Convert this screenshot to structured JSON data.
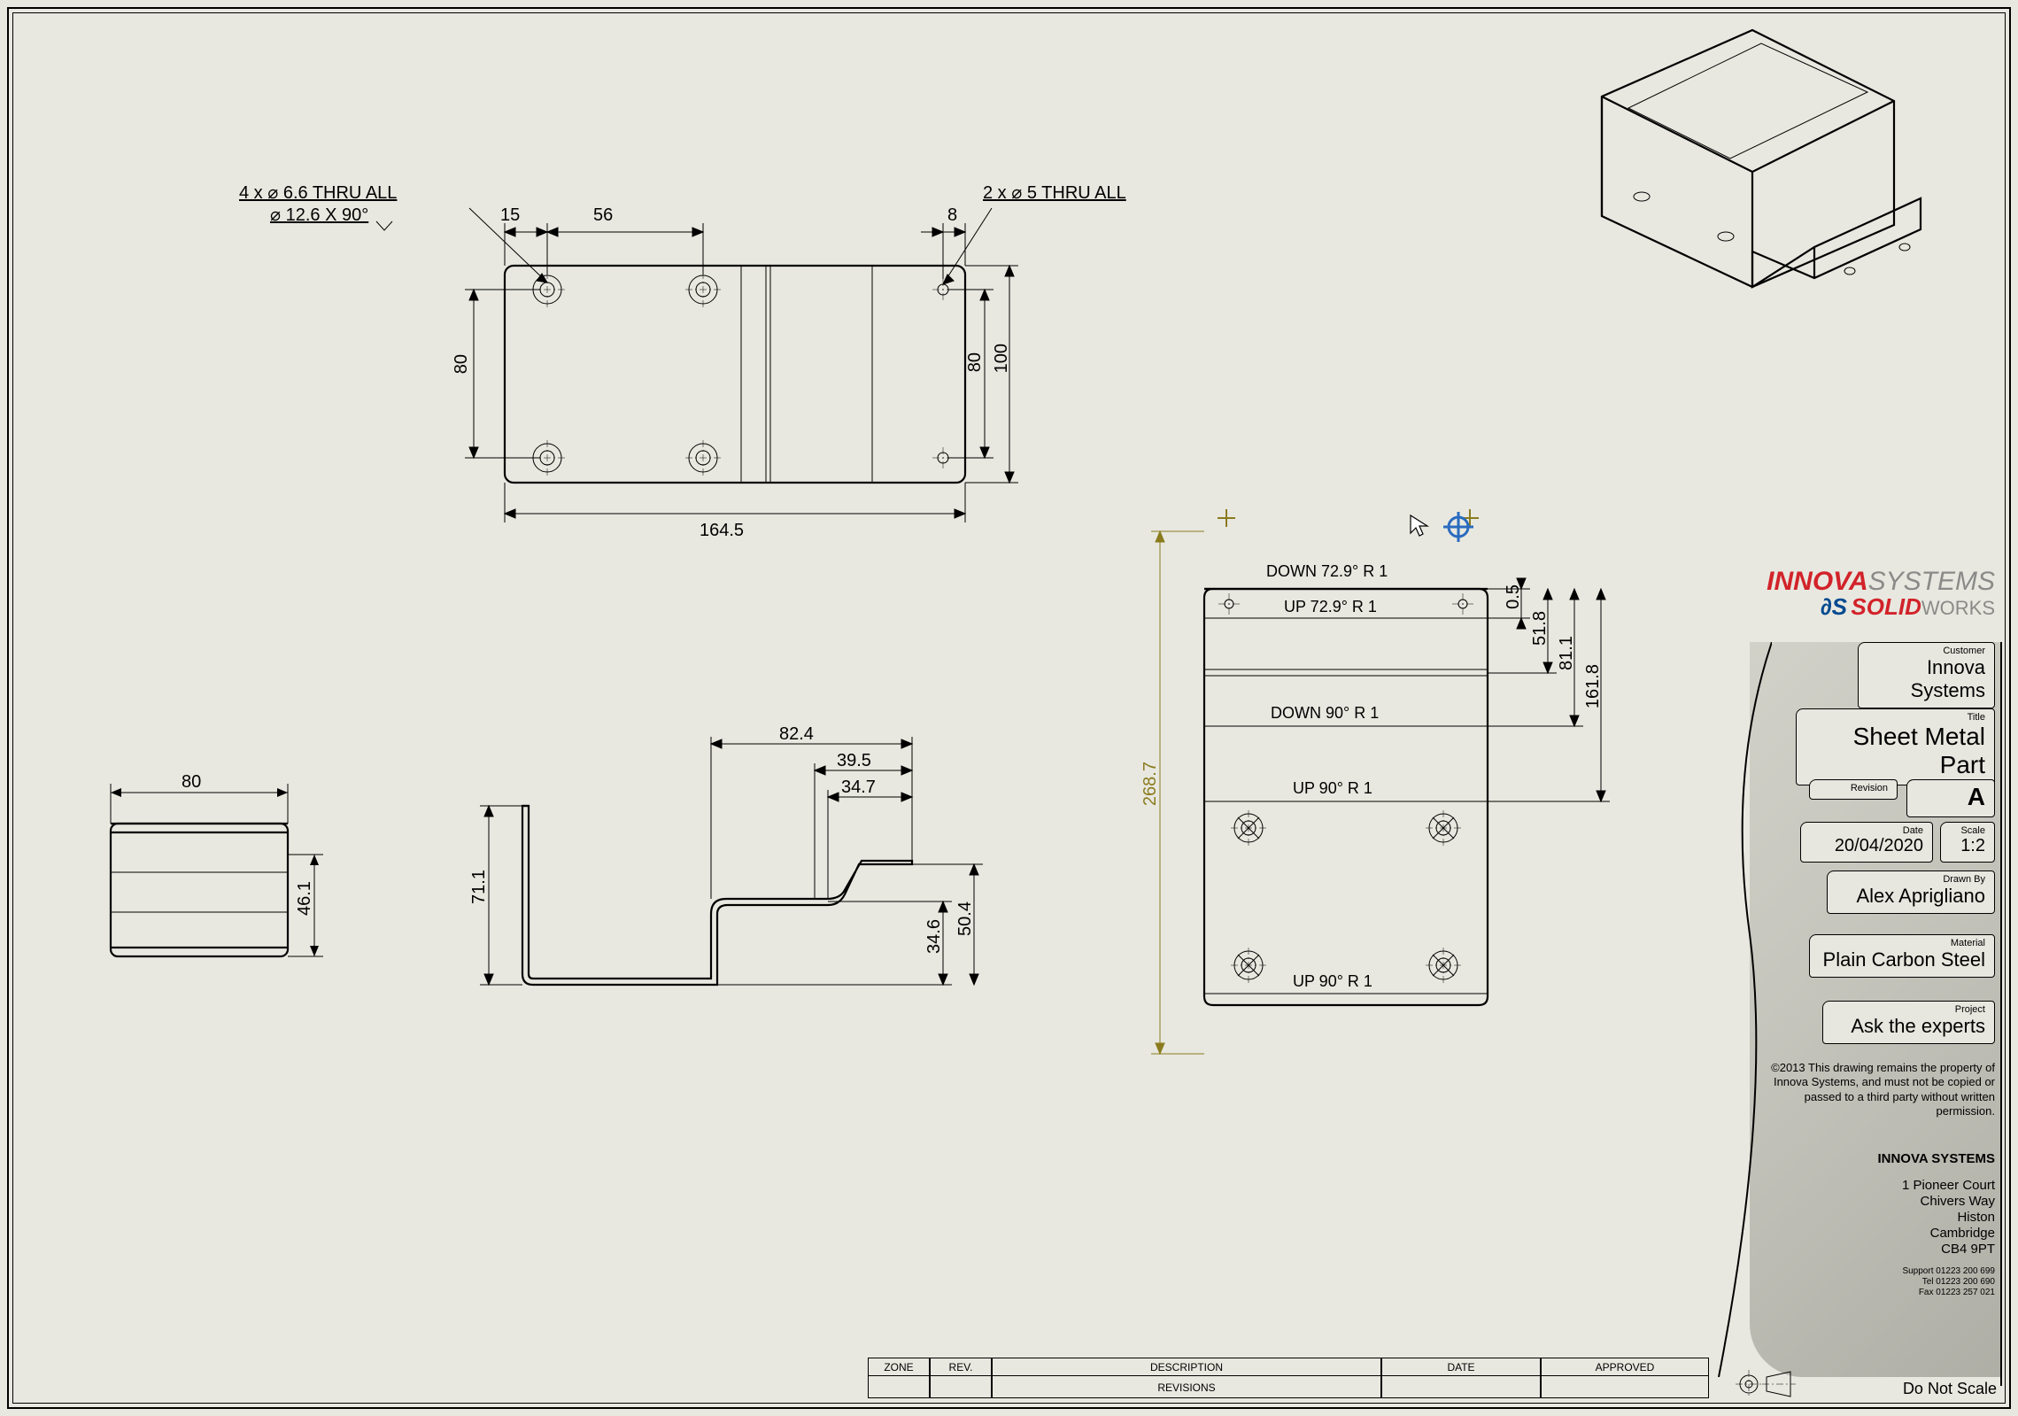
{
  "topview": {
    "holes_left_note_line1": "4 x ⌀ 6.6 THRU ALL",
    "holes_left_note_line2": "⌀ 12.6 X 90°",
    "holes_right_note": "2 x ⌀ 5 THRU ALL",
    "dim_15": "15",
    "dim_56": "56",
    "dim_8": "8",
    "dim_80_v": "80",
    "dim_80_r": "80",
    "dim_100": "100",
    "dim_164_5": "164.5"
  },
  "leftview": {
    "dim_80": "80",
    "dim_46_1": "46.1"
  },
  "frontview": {
    "dim_82_4": "82.4",
    "dim_39_5": "39.5",
    "dim_34_7": "34.7",
    "dim_34_6": "34.6",
    "dim_50_4": "50.4",
    "dim_71_1": "71.1"
  },
  "flatview": {
    "bend1": "DOWN 72.9° R 1",
    "bend2": "UP 72.9° R 1",
    "bend3": "DOWN 90° R 1",
    "bend4": "UP 90° R 1",
    "bend5": "UP 90° R 1",
    "dim_0_5": "0.5",
    "dim_51_8": "51.8",
    "dim_81_1": "81.1",
    "dim_161_8": "161.8",
    "dim_268_7": "268.7"
  },
  "titleblock": {
    "logo_brand1": "INNOVA",
    "logo_brand2": "SYSTEMS",
    "logo_ds": "∂S",
    "logo_solid": "SOLID",
    "logo_works": "WORKS",
    "customer_label": "Customer",
    "customer": "Innova Systems",
    "title_label": "Title",
    "title": "Sheet Metal Part",
    "revision_label": "Revision",
    "revision": "A",
    "date_label": "Date",
    "date": "20/04/2020",
    "scale_label": "Scale",
    "scale": "1:2",
    "drawnby_label": "Drawn By",
    "drawnby": "Alex Aprigliano",
    "material_label": "Material",
    "material": "Plain Carbon Steel",
    "project_label": "Project",
    "project": "Ask the experts",
    "copyright": "©2013 This drawing remains the property of Innova Systems, and must not be copied or passed to a third party without written permission.",
    "company": "INNOVA SYSTEMS",
    "addr1": "1 Pioneer Court",
    "addr2": "Chivers Way",
    "addr3": "Histon",
    "addr4": "Cambridge",
    "addr5": "CB4 9PT",
    "tel1": "Support 01223 200 699",
    "tel2": "Tel 01223 200 690",
    "tel3": "Fax 01223 257 021",
    "do_not_scale": "Do Not Scale"
  },
  "revisions": {
    "zone": "ZONE",
    "rev": "REV.",
    "description": "DESCRIPTION",
    "date": "DATE",
    "approved": "APPROVED",
    "label": "REVISIONS"
  }
}
